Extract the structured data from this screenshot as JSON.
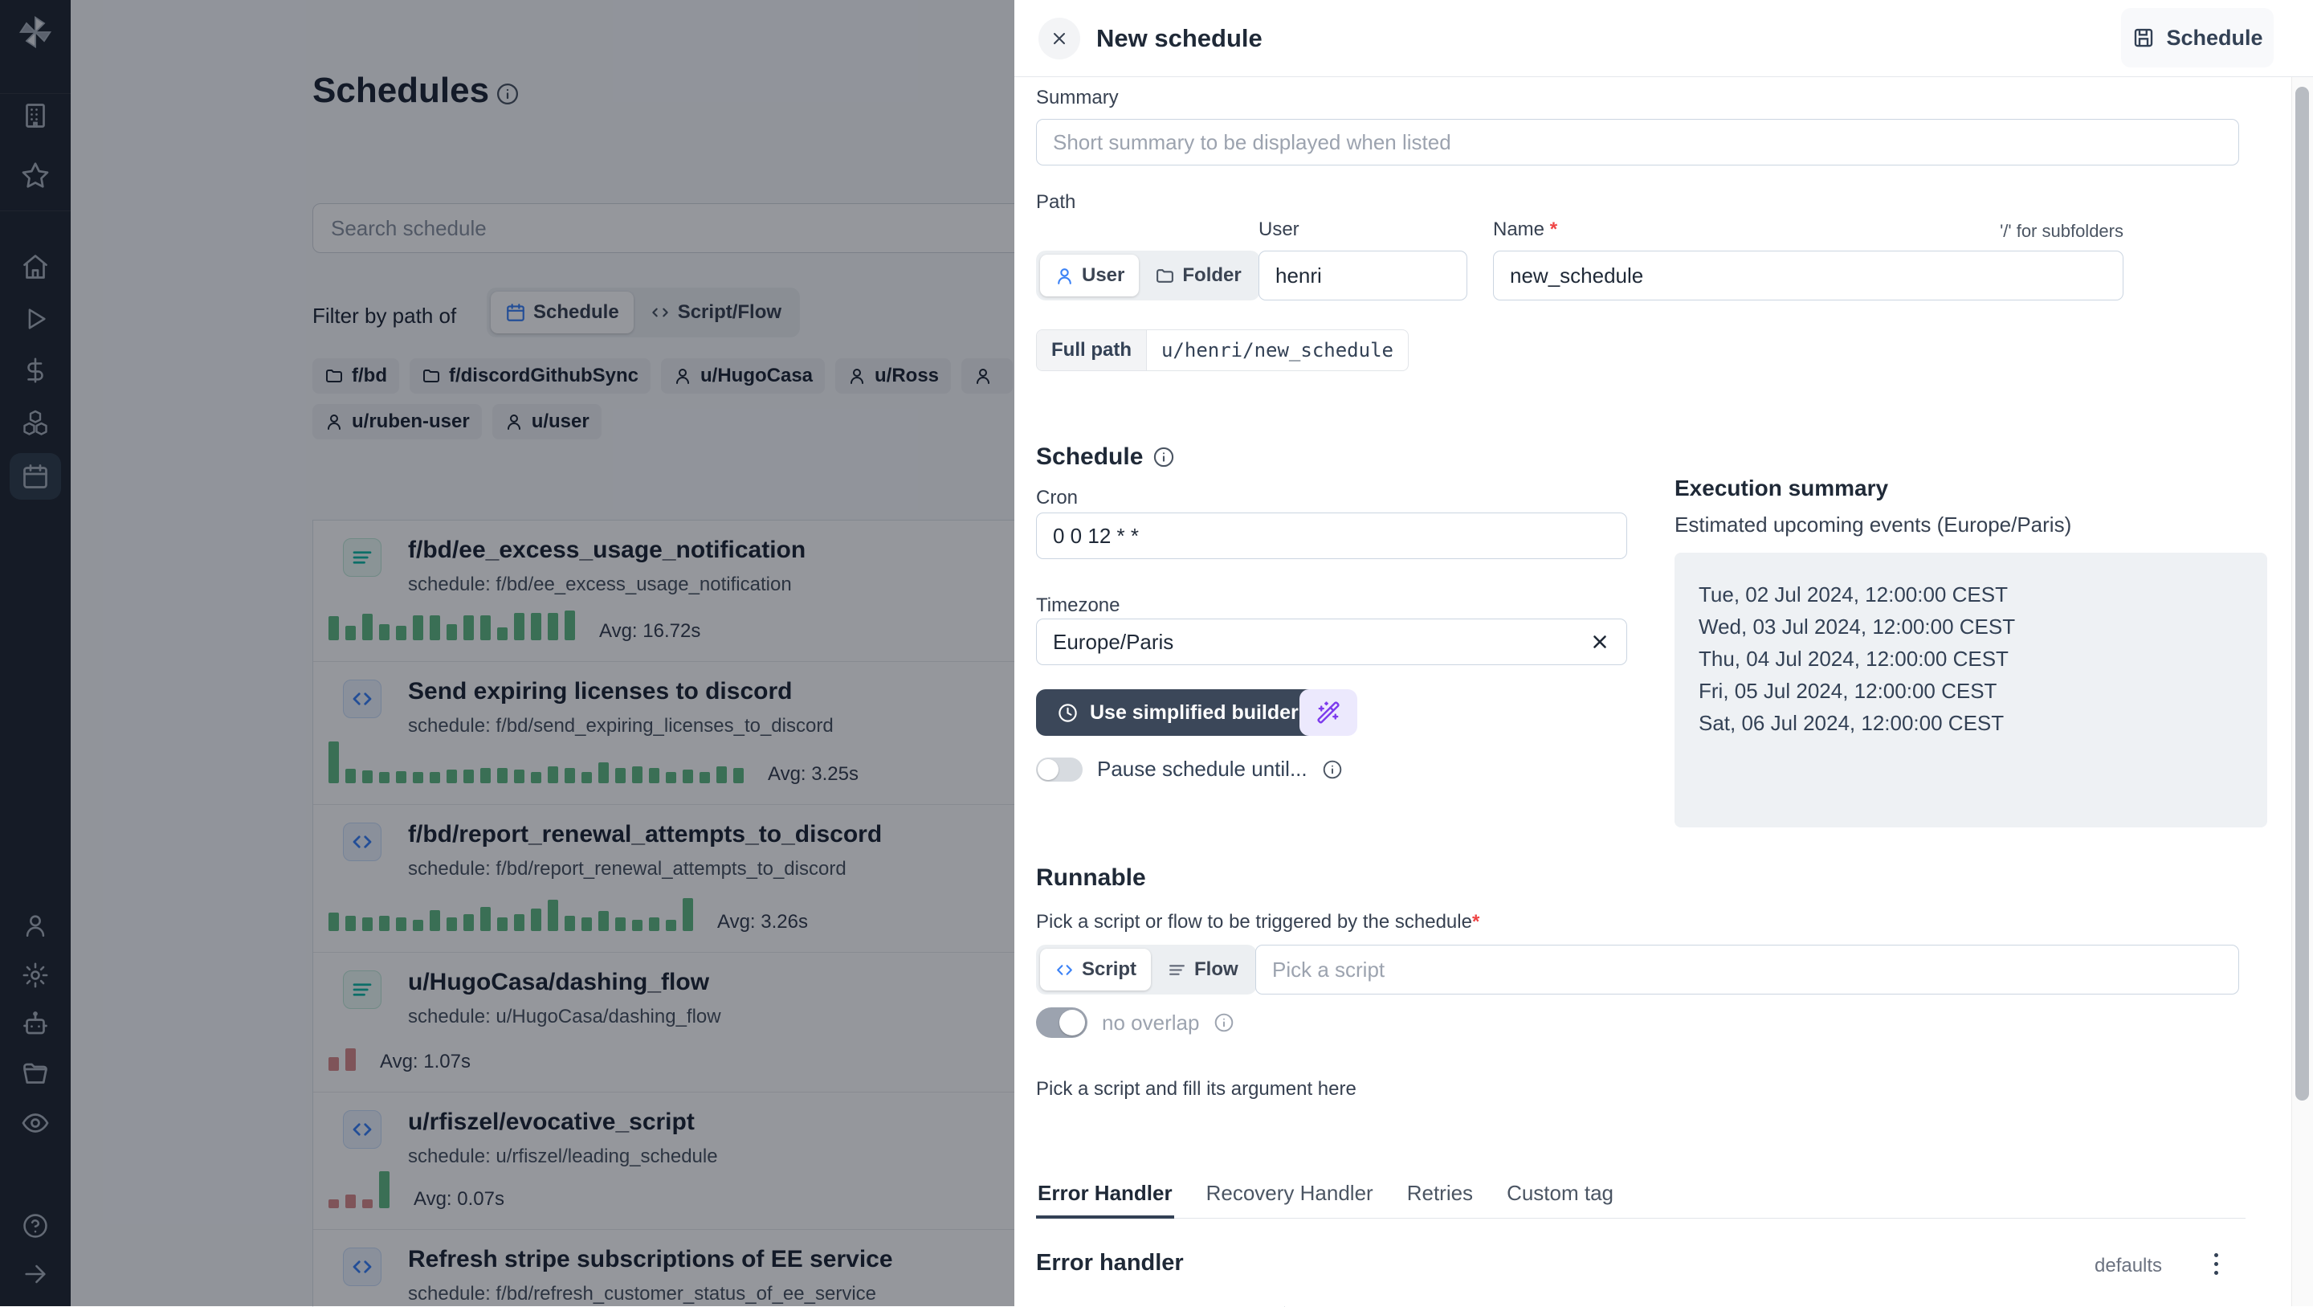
{
  "colors": {
    "accent_blue": "#3b82f6",
    "teal_flow": "#14b8a6",
    "dark_button": "#3b4759",
    "purple": "#7c3aed",
    "green_bar": "#62ba85",
    "red_bar": "#d98c8c"
  },
  "sidebar": {
    "active_item": "schedules-calendar",
    "icons": [
      "windmill-logo",
      "building",
      "star",
      "home",
      "play",
      "dollar",
      "boxes",
      "calendar",
      "user",
      "settings",
      "bot",
      "folder",
      "eye",
      "help",
      "arrow-right"
    ]
  },
  "page": {
    "title": "Schedules",
    "search_placeholder": "Search schedule",
    "filter_label": "Filter by path of",
    "filter_options": [
      {
        "label": "Schedule",
        "selected": true
      },
      {
        "label": "Script/Flow",
        "selected": false
      }
    ],
    "chips": [
      {
        "icon": "folder",
        "label": "f/bd"
      },
      {
        "icon": "folder",
        "label": "f/discordGithubSync"
      },
      {
        "icon": "user",
        "label": "u/HugoCasa"
      },
      {
        "icon": "user",
        "label": "u/Ross"
      },
      {
        "icon": "user",
        "label": ""
      },
      {
        "icon": "user",
        "label": "u/ruben-user"
      },
      {
        "icon": "user",
        "label": "u/user"
      }
    ],
    "schedules": [
      {
        "icon": "flow",
        "title": "f/bd/ee_excess_usage_notification",
        "schedule": "schedule: f/bd/ee_excess_usage_notification",
        "avg": "Avg: 16.72s",
        "bars": [
          {
            "h": 30,
            "c": "g"
          },
          {
            "h": 18,
            "c": "g"
          },
          {
            "h": 33,
            "c": "g"
          },
          {
            "h": 20,
            "c": "g"
          },
          {
            "h": 18,
            "c": "g"
          },
          {
            "h": 31,
            "c": "g"
          },
          {
            "h": 31,
            "c": "g"
          },
          {
            "h": 20,
            "c": "g"
          },
          {
            "h": 31,
            "c": "g"
          },
          {
            "h": 31,
            "c": "g"
          },
          {
            "h": 16,
            "c": "g"
          },
          {
            "h": 34,
            "c": "g"
          },
          {
            "h": 34,
            "c": "g"
          },
          {
            "h": 34,
            "c": "g"
          },
          {
            "h": 37,
            "c": "g"
          }
        ]
      },
      {
        "icon": "script",
        "title": "Send expiring licenses to discord",
        "schedule": "schedule: f/bd/send_expiring_licenses_to_discord",
        "avg": "Avg: 3.25s",
        "bars": [
          {
            "h": 52,
            "c": "g"
          },
          {
            "h": 18,
            "c": "g"
          },
          {
            "h": 16,
            "c": "g"
          },
          {
            "h": 14,
            "c": "g"
          },
          {
            "h": 15,
            "c": "g"
          },
          {
            "h": 14,
            "c": "g"
          },
          {
            "h": 14,
            "c": "g"
          },
          {
            "h": 17,
            "c": "g"
          },
          {
            "h": 17,
            "c": "g"
          },
          {
            "h": 19,
            "c": "g"
          },
          {
            "h": 19,
            "c": "g"
          },
          {
            "h": 17,
            "c": "g"
          },
          {
            "h": 14,
            "c": "g"
          },
          {
            "h": 21,
            "c": "g"
          },
          {
            "h": 19,
            "c": "g"
          },
          {
            "h": 14,
            "c": "g"
          },
          {
            "h": 26,
            "c": "g"
          },
          {
            "h": 19,
            "c": "g"
          },
          {
            "h": 21,
            "c": "g"
          },
          {
            "h": 19,
            "c": "g"
          },
          {
            "h": 14,
            "c": "g"
          },
          {
            "h": 17,
            "c": "g"
          },
          {
            "h": 14,
            "c": "g"
          },
          {
            "h": 21,
            "c": "g"
          },
          {
            "h": 19,
            "c": "g"
          }
        ]
      },
      {
        "icon": "script",
        "title": "f/bd/report_renewal_attempts_to_discord",
        "schedule": "schedule: f/bd/report_renewal_attempts_to_discord",
        "avg": "Avg: 3.26s",
        "bars": [
          {
            "h": 23,
            "c": "g"
          },
          {
            "h": 19,
            "c": "g"
          },
          {
            "h": 17,
            "c": "g"
          },
          {
            "h": 19,
            "c": "g"
          },
          {
            "h": 17,
            "c": "g"
          },
          {
            "h": 14,
            "c": "g"
          },
          {
            "h": 26,
            "c": "g"
          },
          {
            "h": 17,
            "c": "g"
          },
          {
            "h": 21,
            "c": "g"
          },
          {
            "h": 30,
            "c": "g"
          },
          {
            "h": 17,
            "c": "g"
          },
          {
            "h": 21,
            "c": "g"
          },
          {
            "h": 28,
            "c": "g"
          },
          {
            "h": 39,
            "c": "g"
          },
          {
            "h": 19,
            "c": "g"
          },
          {
            "h": 17,
            "c": "g"
          },
          {
            "h": 25,
            "c": "g"
          },
          {
            "h": 17,
            "c": "g"
          },
          {
            "h": 14,
            "c": "g"
          },
          {
            "h": 17,
            "c": "g"
          },
          {
            "h": 14,
            "c": "g"
          },
          {
            "h": 41,
            "c": "g"
          }
        ]
      },
      {
        "icon": "flow",
        "title": "u/HugoCasa/dashing_flow",
        "schedule": "schedule: u/HugoCasa/dashing_flow",
        "avg": "Avg: 1.07s",
        "bars": [
          {
            "h": 17,
            "c": "r"
          },
          {
            "h": 28,
            "c": "r"
          }
        ]
      },
      {
        "icon": "script",
        "title": "u/rfiszel/evocative_script",
        "schedule": "schedule: u/rfiszel/leading_schedule",
        "avg": "Avg: 0.07s",
        "bars": [
          {
            "h": 11,
            "c": "r"
          },
          {
            "h": 17,
            "c": "r"
          },
          {
            "h": 11,
            "c": "r"
          },
          {
            "h": 46,
            "c": "g"
          }
        ]
      },
      {
        "icon": "script",
        "title": "Refresh stripe subscriptions of EE service",
        "schedule": "schedule: f/bd/refresh_customer_status_of_ee_service",
        "avg": "",
        "bars": []
      }
    ]
  },
  "drawer": {
    "title": "New schedule",
    "save_button": "Schedule",
    "summary_label": "Summary",
    "summary_placeholder": "Short summary to be displayed when listed",
    "path": {
      "label": "Path",
      "owner_options": [
        {
          "label": "User",
          "selected": true
        },
        {
          "label": "Folder",
          "selected": false
        }
      ],
      "user_label": "User",
      "user_value": "henri",
      "name_label": "Name",
      "required_mark": "*",
      "subfolder_hint": "'/' for subfolders",
      "name_value": "new_schedule",
      "full_path_label": "Full path",
      "full_path_value": "u/henri/new_schedule"
    },
    "schedule": {
      "heading": "Schedule",
      "cron_label": "Cron",
      "cron_value": "0 0 12 * *",
      "timezone_label": "Timezone",
      "timezone_value": "Europe/Paris",
      "builder_button": "Use simplified builder",
      "pause_label": "Pause schedule until..."
    },
    "execution": {
      "heading": "Execution summary",
      "subheading": "Estimated upcoming events (Europe/Paris)",
      "events": [
        "Tue, 02 Jul 2024, 12:00:00 CEST",
        "Wed, 03 Jul 2024, 12:00:00 CEST",
        "Thu, 04 Jul 2024, 12:00:00 CEST",
        "Fri, 05 Jul 2024, 12:00:00 CEST",
        "Sat, 06 Jul 2024, 12:00:00 CEST"
      ]
    },
    "runnable": {
      "heading": "Runnable",
      "pick_label": "Pick a script or flow to be triggered by the schedule",
      "required_mark": "*",
      "type_options": [
        {
          "label": "Script",
          "selected": true
        },
        {
          "label": "Flow",
          "selected": false
        }
      ],
      "picker_placeholder": "Pick a script",
      "no_overlap_label": "no overlap",
      "args_hint": "Pick a script and fill its argument here"
    },
    "tabs": [
      {
        "label": "Error Handler",
        "active": true
      },
      {
        "label": "Recovery Handler",
        "active": false
      },
      {
        "label": "Retries",
        "active": false
      },
      {
        "label": "Custom tag",
        "active": false
      }
    ],
    "error_handler": {
      "heading": "Error handler",
      "defaults_label": "defaults"
    }
  }
}
